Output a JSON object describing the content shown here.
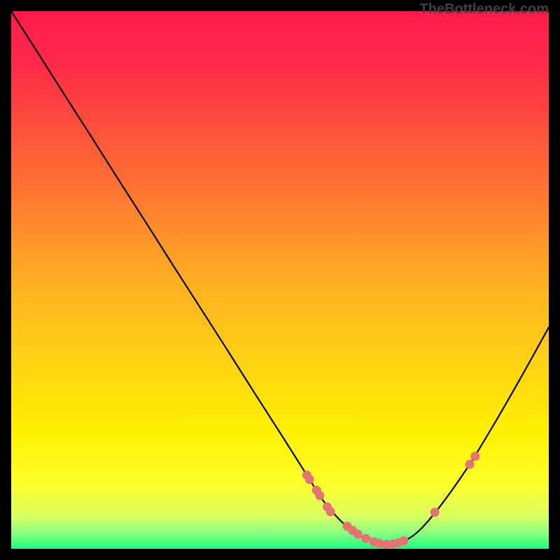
{
  "watermark": "TheBottleneck.com",
  "gradient": {
    "stops": [
      {
        "offset": 0.0,
        "color": "#ff1a4d"
      },
      {
        "offset": 0.1,
        "color": "#ff2a49"
      },
      {
        "offset": 0.2,
        "color": "#ff4a3d"
      },
      {
        "offset": 0.35,
        "color": "#ff7a30"
      },
      {
        "offset": 0.5,
        "color": "#ffae22"
      },
      {
        "offset": 0.65,
        "color": "#ffd214"
      },
      {
        "offset": 0.78,
        "color": "#fff000"
      },
      {
        "offset": 0.88,
        "color": "#fdff2a"
      },
      {
        "offset": 0.94,
        "color": "#d8ff60"
      },
      {
        "offset": 0.97,
        "color": "#8cff80"
      },
      {
        "offset": 1.0,
        "color": "#1aff80"
      }
    ]
  },
  "chart_data": {
    "type": "line",
    "title": "",
    "xlabel": "",
    "ylabel": "",
    "xrange": [
      0,
      100
    ],
    "yrange": [
      0,
      100
    ],
    "series": [
      {
        "name": "curve",
        "x": [
          0,
          5,
          10,
          15,
          20,
          25,
          30,
          35,
          40,
          45,
          50,
          55,
          58,
          61,
          64,
          67,
          70,
          73,
          76,
          80,
          85,
          90,
          95,
          100
        ],
        "y": [
          100,
          92.2,
          84.3,
          76.5,
          68.6,
          60.8,
          52.9,
          45.1,
          37.3,
          29.4,
          21.6,
          13.7,
          9.0,
          5.5,
          2.9,
          1.4,
          0.8,
          1.4,
          3.5,
          8.2,
          15.3,
          23.5,
          32.2,
          41.2
        ]
      }
    ],
    "markers": [
      {
        "x": 55.0,
        "y": 13.7
      },
      {
        "x": 55.5,
        "y": 12.9
      },
      {
        "x": 56.8,
        "y": 10.9
      },
      {
        "x": 57.4,
        "y": 9.9
      },
      {
        "x": 58.8,
        "y": 7.8
      },
      {
        "x": 59.4,
        "y": 6.9
      },
      {
        "x": 62.5,
        "y": 4.2
      },
      {
        "x": 63.5,
        "y": 3.4
      },
      {
        "x": 64.5,
        "y": 2.7
      },
      {
        "x": 66.0,
        "y": 1.9
      },
      {
        "x": 67.5,
        "y": 1.3
      },
      {
        "x": 68.5,
        "y": 1.0
      },
      {
        "x": 69.8,
        "y": 0.8
      },
      {
        "x": 71.0,
        "y": 0.9
      },
      {
        "x": 72.0,
        "y": 1.1
      },
      {
        "x": 73.0,
        "y": 1.5
      },
      {
        "x": 78.8,
        "y": 6.8
      },
      {
        "x": 85.3,
        "y": 15.7
      },
      {
        "x": 86.3,
        "y": 17.2
      }
    ],
    "marker_style": {
      "radius_px": 6.5,
      "fill": "#e57373"
    },
    "curve_style": {
      "stroke": "#000000",
      "stroke_width_px": 2.2
    }
  }
}
